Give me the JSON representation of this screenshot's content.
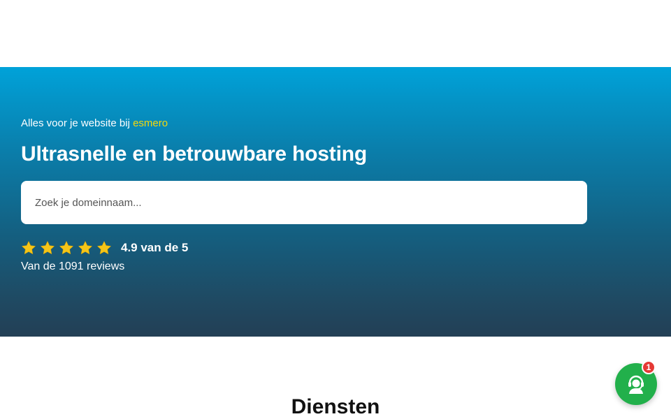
{
  "hero": {
    "eyebrow_prefix": "Alles voor je website bij",
    "eyebrow_brand": "esmero",
    "headline": "Ultrasnelle en betrouwbare hosting",
    "search": {
      "placeholder": "Zoek je domeinnaam...",
      "value": ""
    },
    "rating": {
      "score": 4.9,
      "max": 5,
      "text": "4.9 van de 5",
      "reviews_text": "Van de 1091 reviews",
      "star_icon": "star-icon",
      "star_color": "#f5c518"
    }
  },
  "section": {
    "title": "Diensten"
  },
  "chat": {
    "icon": "support-agent-icon",
    "badge_count": "1",
    "color": "#22b04b",
    "badge_color": "#e53935"
  },
  "colors": {
    "brand_accent": "#f5d90a",
    "hero_top": "#00a2d9",
    "hero_bottom": "#233f55"
  }
}
